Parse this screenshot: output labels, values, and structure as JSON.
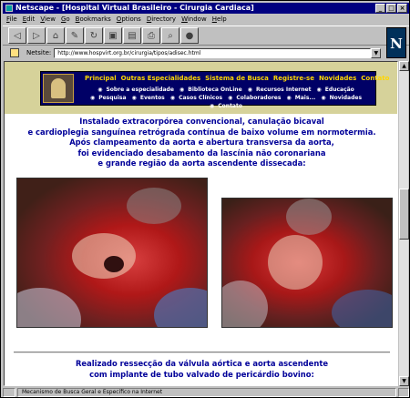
{
  "window": {
    "title": "Netscape - [Hospital Virtual Brasileiro - Cirurgia Cardiaca]"
  },
  "menu": [
    "File",
    "Edit",
    "View",
    "Go",
    "Bookmarks",
    "Options",
    "Directory",
    "Window",
    "Help"
  ],
  "toolbar_icons": [
    "back-icon",
    "forward-icon",
    "home-icon",
    "edit-icon",
    "reload-icon",
    "images-icon",
    "open-icon",
    "print-icon",
    "find-icon",
    "stop-icon"
  ],
  "location": {
    "label": "Netsite:",
    "url": "http://www.hospvirt.org.br/cirurgia/tipos/adisec.html"
  },
  "nav": {
    "top": [
      "Principal",
      "Outras Especialidades",
      "Sistema de Busca",
      "Registre-se",
      "Novidades",
      "Contato"
    ],
    "sub": [
      "Sobre a especialidade",
      "Biblioteca OnLine",
      "Recursos Internet",
      "Educação",
      "Pesquisa",
      "Eventos",
      "Casos Clínicos",
      "Colaboradores",
      "Mais...",
      "Novidades",
      "Contato"
    ]
  },
  "content": {
    "para1": [
      "Instalado extracorpórea convencional, canulação bicaval",
      "e cardioplegia sanguínea retrógrada contínua de baixo volume em normotermia.",
      "Após clampeamento da aorta e abertura transversa da aorta,",
      "foi evidenciado desabamento da lascínia não coronariana",
      "e grande região da aorta ascendente dissecada:"
    ],
    "para2": [
      "Realizado ressecção da válvula aórtica e aorta ascendente",
      "com implante de tubo valvado de pericárdio bovino:"
    ]
  },
  "status": {
    "text": "Mecanismo de Busca Geral e Específico na Internet"
  },
  "colors": {
    "title_bar": "#000080",
    "nav_bg": "#000066",
    "nav_link": "#ffd700",
    "text_blue": "#000099",
    "header_strip": "#d6d29a"
  }
}
